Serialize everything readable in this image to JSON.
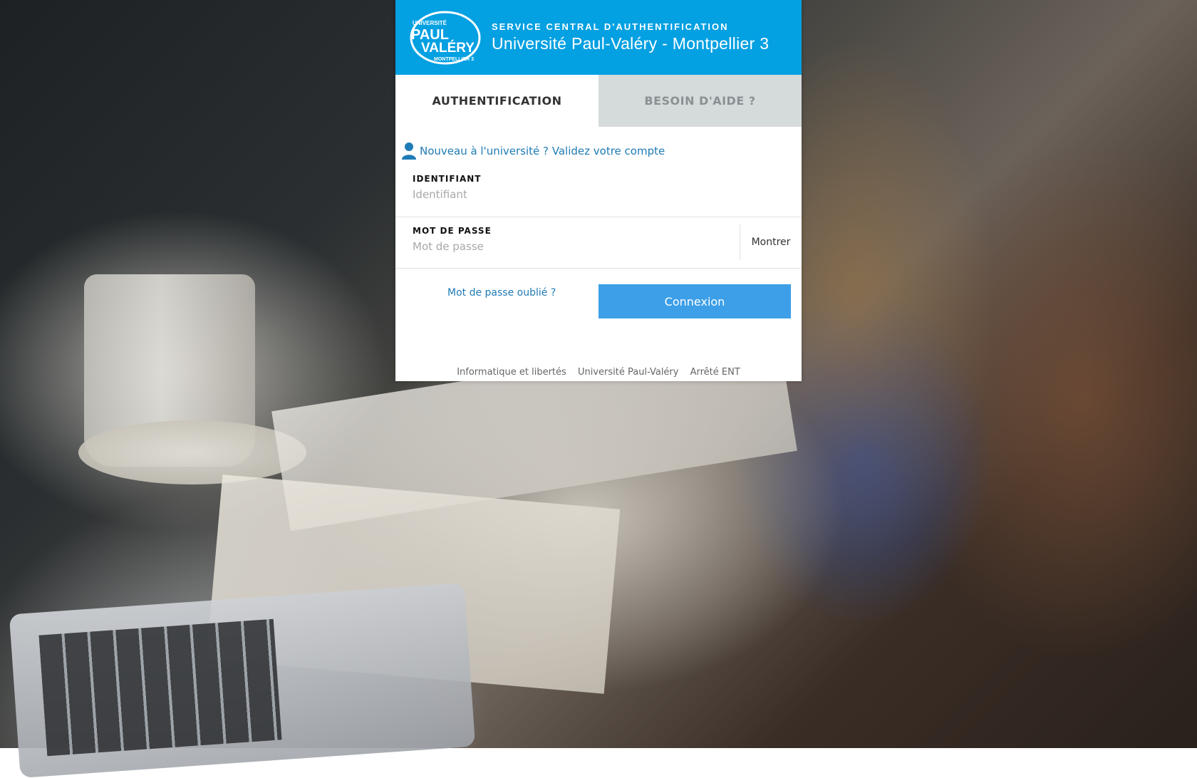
{
  "header": {
    "logo_lines": [
      "UNIVERSITÉ",
      "PAUL",
      "VALÉRY",
      "MONTPELLIER 3"
    ],
    "subtitle": "SERVICE CENTRAL D'AUTHENTIFICATION",
    "title": "Université Paul-Valéry - Montpellier 3",
    "color": "#03a0e2"
  },
  "tabs": [
    {
      "label": "AUTHENTIFICATION",
      "active": true
    },
    {
      "label": "BESOIN D'AIDE ?",
      "active": false
    }
  ],
  "new_account": {
    "icon": "user-icon",
    "label": "Nouveau à l'université ? Validez votre compte"
  },
  "form": {
    "identifiant": {
      "label": "IDENTIFIANT",
      "placeholder": "Identifiant",
      "value": ""
    },
    "password": {
      "label": "MOT DE PASSE",
      "placeholder": "Mot de passe",
      "value": "",
      "show_label": "Montrer"
    },
    "forgot_label": "Mot de passe oublié ?",
    "submit_label": "Connexion",
    "submit_color": "#3c9fe8"
  },
  "footer": {
    "links": [
      "Informatique et libertés",
      "Université Paul-Valéry",
      "Arrêté ENT"
    ]
  }
}
